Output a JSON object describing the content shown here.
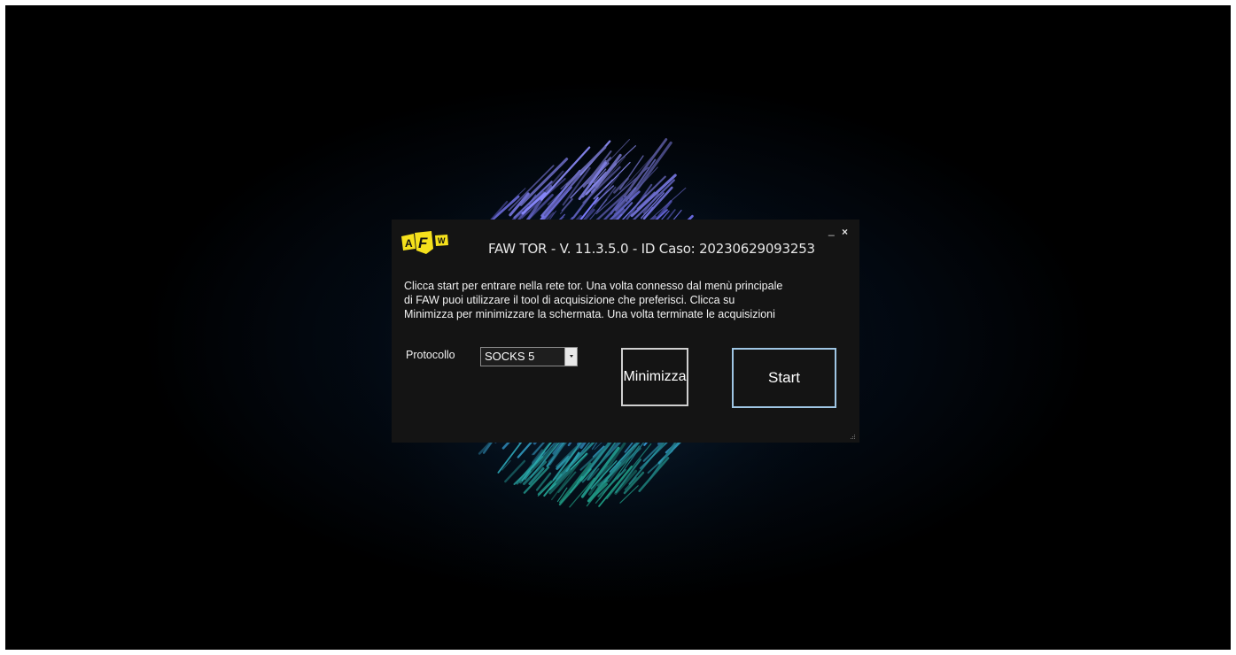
{
  "window": {
    "title": "FAW TOR - V. 11.3.5.0 - ID Caso:  20230629093253",
    "minimize_glyph": "_",
    "close_glyph": "×"
  },
  "logo": {
    "letters": [
      "A",
      "F",
      "W"
    ],
    "color": "#f5e11c"
  },
  "description": "Clicca start per entrare nella rete tor. Una volta connesso dal menù principale\ndi FAW puoi utilizzare il tool di acquisizione che preferisci. Clicca su\nMinimizza per minimizzare la schermata. Una volta terminate le acquisizioni",
  "protocol": {
    "label": "Protocollo",
    "selected": "SOCKS 5"
  },
  "buttons": {
    "minimize": "Minimizza",
    "start": "Start"
  },
  "colors": {
    "dialog_bg": "#141414",
    "desktop_bg": "#000000",
    "start_border": "#9fc6e4",
    "accent_yellow": "#f5e11c"
  }
}
